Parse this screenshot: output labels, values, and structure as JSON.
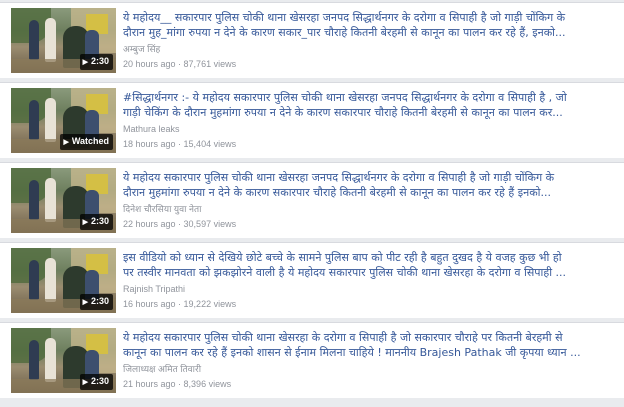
{
  "videos": [
    {
      "title_line1": "ये महोदय__ सकारपार पुलिस चोकी थाना खेसरहा जनपद सिद्धार्थनगर के दरोगा व सिपाही है जो गाड़ी चोंकिग के",
      "title_line2": "दौरान मुह_मांगा रुपया न देने के कारण सकार_पार चौराहे कितनी बेरहमी से कानून का पालन कर रहे हैं, इनको...",
      "channel": "अम्बुज सिंह",
      "time": "20 hours ago",
      "views": "87,761 views",
      "badge": "2:30"
    },
    {
      "title_line1": "#सिद्धार्थनगर :- ये महोदय सकारपार पुलिस चोकी थाना खेसरहा जनपद सिद्धार्थनगर के दरोगा व सिपाही है , जो",
      "title_line2": "गाड़ी चेकिंग के दौरान मुहमांगा रुपया न देने के कारण सकारपार चौराहे कितनी बेरहमी से कानून का पालन कर...",
      "channel": "Mathura leaks",
      "time": "18 hours ago",
      "views": "15,404 views",
      "badge": "Watched"
    },
    {
      "title_line1": "ये महोदय सकारपार पुलिस चोकी थाना खेसरहा जनपद सिद्धार्थनगर के दरोगा व सिपाही है जो गाड़ी चोंकिग के",
      "title_line2": "दौरान मुहमांगा रुपया न देने के कारण सकारपार चौराहे कितनी बेरहमी से कानून का पालन कर रहे हैं इनको...",
      "channel": "दिनेश चौरसिया युवा नेता",
      "time": "22 hours ago",
      "views": "30,597 views",
      "badge": "2:30"
    },
    {
      "title_line1": "इस वीडियो को ध्यान से देखिये छोटे बच्चे के सामने पुलिस बाप को पीट रही है बहुत दुखद है ये वजह कुछ भी हो",
      "title_line2": "पर तस्वीर मानवता को झकझोरने वाली है ये महोदय सकारपार पुलिस चोकी थाना खेसरहा के दरोगा व सिपाही ...",
      "channel": "Rajnish Tripathi",
      "time": "16 hours ago",
      "views": "19,222 views",
      "badge": "2:30"
    },
    {
      "title_line1": "ये महोदय सकारपार पुलिस चोकी थाना खेसरहा के दरोगा व सिपाही है जो सकारपार चौराहे पर कितनी बेरहमी से",
      "title_line2": "कानून का पालन कर रहे हैं इनको शासन से ईनाम मिलना चाहिये ! माननीय Brajesh Pathak जी कृपया ध्यान ...",
      "channel": "जिलाध्यक्ष अमित तिवारी",
      "time": "21 hours ago",
      "views": "8,396 views",
      "badge": "2:30"
    }
  ]
}
